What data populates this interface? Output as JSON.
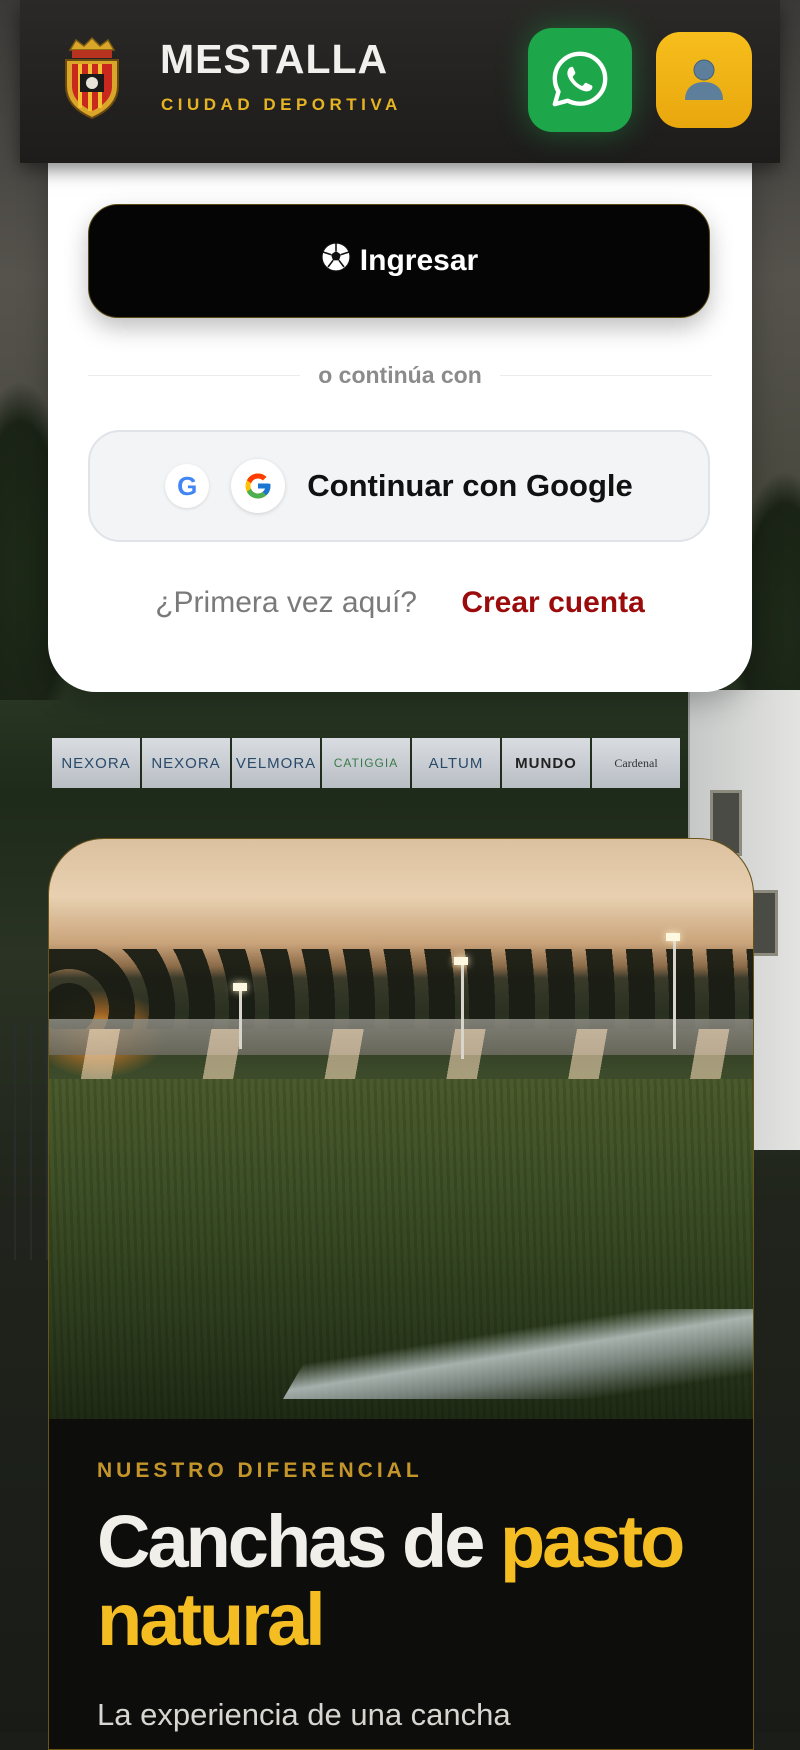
{
  "header": {
    "title": "MESTALLA",
    "subtitle": "CIUDAD DEPORTIVA",
    "crest_icon": "club-crest-icon",
    "whatsapp_icon": "whatsapp-icon",
    "user_icon": "user-icon"
  },
  "login": {
    "submit_label": "Ingresar",
    "submit_icon": "soccer-ball-icon",
    "divider_text": "o continúa con",
    "google_letter": "G",
    "google_label": "Continuar con Google",
    "first_time_text": "¿Primera vez aquí?",
    "create_account_label": "Crear cuenta"
  },
  "sponsors": [
    "NEXORA",
    "NEXORA",
    "VELMORA",
    "CATIGGIA",
    "ALTUM",
    "MUNDO",
    "Cardenal"
  ],
  "promo": {
    "eyebrow": "NUESTRO DIFERENCIAL",
    "headline_white": "Canchas de ",
    "headline_gold_1": "pasto",
    "headline_gold_2": "natural",
    "body": "La experiencia de una cancha"
  },
  "colors": {
    "brand_gold": "#f4bd21",
    "whatsapp_green": "#1ea64a",
    "danger_red": "#9b0b0b",
    "dark": "#050505"
  }
}
